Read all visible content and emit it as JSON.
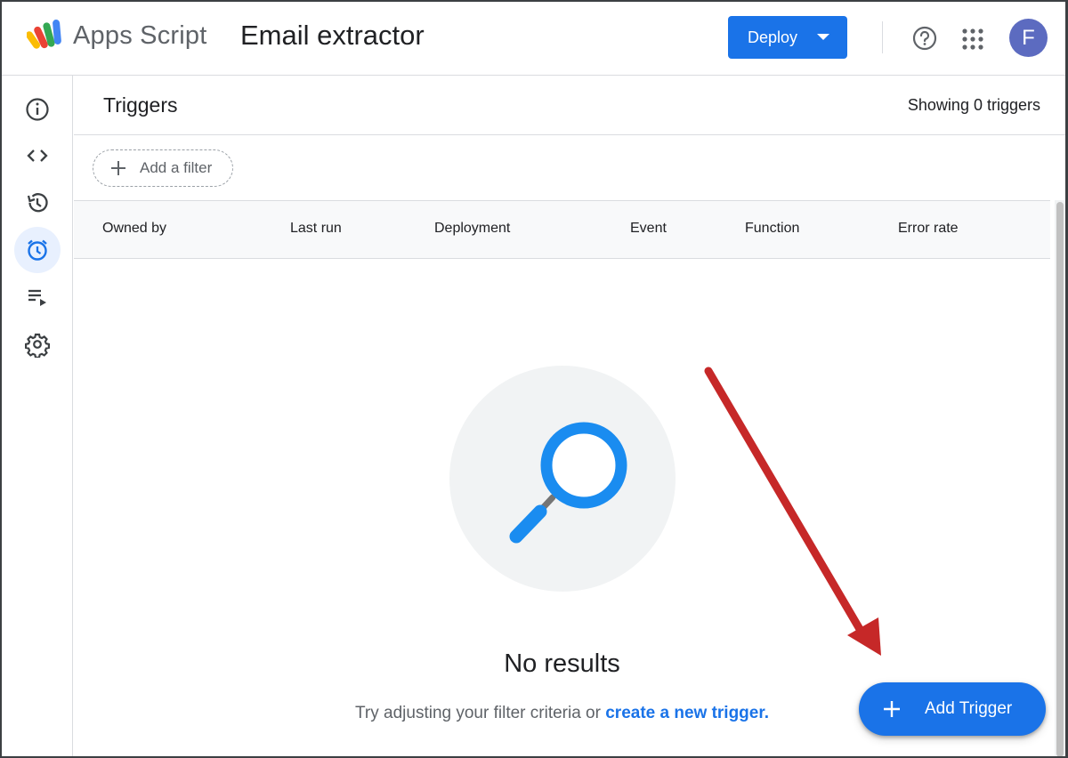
{
  "header": {
    "app_name": "Apps Script",
    "project_title": "Email extractor",
    "deploy_label": "Deploy",
    "avatar_initial": "F"
  },
  "rail": {
    "items": [
      {
        "name": "info-icon"
      },
      {
        "name": "code-icon"
      },
      {
        "name": "history-icon"
      },
      {
        "name": "alarm-icon",
        "active": true
      },
      {
        "name": "executions-icon"
      },
      {
        "name": "gear-icon"
      }
    ]
  },
  "main": {
    "title": "Triggers",
    "showing": "Showing 0 triggers",
    "filter_label": "Add a filter",
    "columns": [
      "Owned by",
      "Last run",
      "Deployment",
      "Event",
      "Function",
      "Error rate"
    ],
    "empty_title": "No results",
    "empty_hint": "Try adjusting your filter criteria or",
    "empty_link": "create a new trigger.",
    "add_trigger_label": "Add Trigger"
  },
  "colors": {
    "accent": "#1a73e8",
    "annotation_arrow": "#c62828",
    "avatar": "#5c6bc0"
  }
}
